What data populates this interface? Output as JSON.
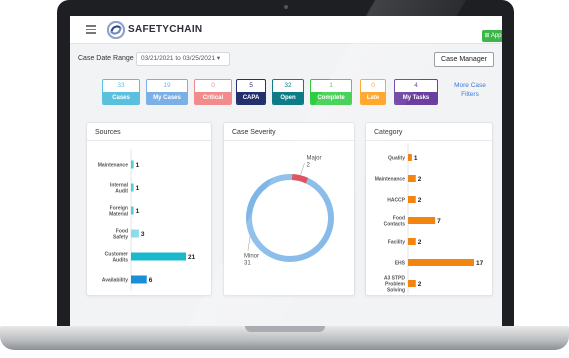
{
  "app": {
    "brand": "SAFETYCHAIN",
    "app_button": "App",
    "case_date_range_label": "Case Date Range",
    "case_date_range_value": "03/21/2021 to 03/25/2021",
    "case_manager_button": "Case Manager",
    "more_filters": "More Case Filters"
  },
  "tiles": [
    {
      "count": "33",
      "label": "Cases",
      "color": "#5bc0de"
    },
    {
      "count": "19",
      "label": "My Cases",
      "color": "#7ab0e6"
    },
    {
      "count": "0",
      "label": "Critical",
      "color": "#f28b8b"
    },
    {
      "count": "5",
      "label": "CAPA",
      "color": "#24306e"
    },
    {
      "count": "32",
      "label": "Open",
      "color": "#0e7c86"
    },
    {
      "count": "1",
      "label": "Complete",
      "color": "#2ecc40"
    },
    {
      "count": "0",
      "label": "Late",
      "color": "#ff9f1a"
    },
    {
      "count": "4",
      "label": "My Tasks",
      "color": "#6b3fa0"
    }
  ],
  "cards": {
    "sources_title": "Sources",
    "severity_title": "Case Severity",
    "category_title": "Category"
  },
  "chart_data": [
    {
      "type": "bar",
      "title": "Sources",
      "orientation": "horizontal",
      "categories": [
        "Maintenance",
        "Internal Audit",
        "Foreign Material",
        "Food Safety",
        "Customer Audits",
        "Availability"
      ],
      "values": [
        1,
        1,
        1,
        3,
        21,
        6
      ],
      "colors": [
        "#5bc8dc",
        "#5bc8dc",
        "#5bc8dc",
        "#8edcea",
        "#1bb8cc",
        "#1b8fd6"
      ]
    },
    {
      "type": "pie",
      "title": "Case Severity",
      "categories": [
        "Major",
        "Minor"
      ],
      "values": [
        2,
        31
      ],
      "colors": [
        "#d93a4a",
        "#7fb6e8"
      ]
    },
    {
      "type": "bar",
      "title": "Category",
      "orientation": "horizontal",
      "categories": [
        "Quality",
        "Maintenance",
        "HACCP",
        "Food Contacts",
        "Facility",
        "EHS",
        "A3 STPD Problem Solving"
      ],
      "values": [
        1,
        2,
        2,
        7,
        2,
        17,
        2
      ],
      "colors": [
        "#f2850f",
        "#f2850f",
        "#f2850f",
        "#f2850f",
        "#f2850f",
        "#f2850f",
        "#f2850f"
      ]
    }
  ]
}
